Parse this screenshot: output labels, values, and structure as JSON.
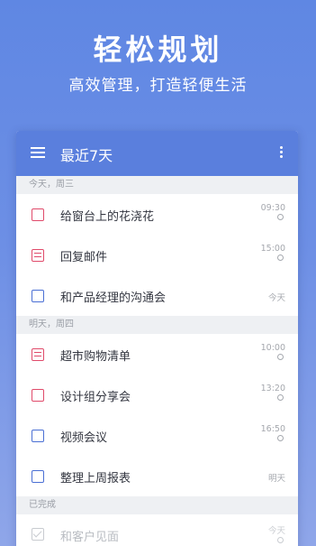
{
  "promo": {
    "title": "轻松规划",
    "subtitle": "高效管理，打造轻便生活"
  },
  "appbar": {
    "title": "最近7天",
    "menu_icon": "hamburger-menu-icon",
    "more_icon": "more-vertical-icon"
  },
  "colors": {
    "accent": "#5a7fdd",
    "priority_high": "#e04a6a",
    "priority_normal": "#4a6fd4"
  },
  "sections": [
    {
      "header": "今天，周三",
      "tasks": [
        {
          "label": "给窗台上的花浇花",
          "time": "09:30",
          "checkbox_color": "#e04a6a",
          "type": "task"
        },
        {
          "label": "回复邮件",
          "time": "15:00",
          "checkbox_color": "#e04a6a",
          "type": "note"
        },
        {
          "label": "和产品经理的沟通会",
          "due": "今天",
          "checkbox_color": "#4a6fd4",
          "type": "task"
        }
      ]
    },
    {
      "header": "明天，周四",
      "tasks": [
        {
          "label": "超市购物清单",
          "time": "10:00",
          "checkbox_color": "#e04a6a",
          "type": "note"
        },
        {
          "label": "设计组分享会",
          "time": "13:20",
          "checkbox_color": "#e04a6a",
          "type": "task"
        },
        {
          "label": "视频会议",
          "time": "16:50",
          "checkbox_color": "#4a6fd4",
          "type": "task"
        },
        {
          "label": "整理上周报表",
          "due": "明天",
          "checkbox_color": "#4a6fd4",
          "type": "task"
        }
      ]
    },
    {
      "header": "已完成",
      "tasks": [
        {
          "label": "和客户见面",
          "time": "今天",
          "completed": true
        }
      ]
    }
  ]
}
